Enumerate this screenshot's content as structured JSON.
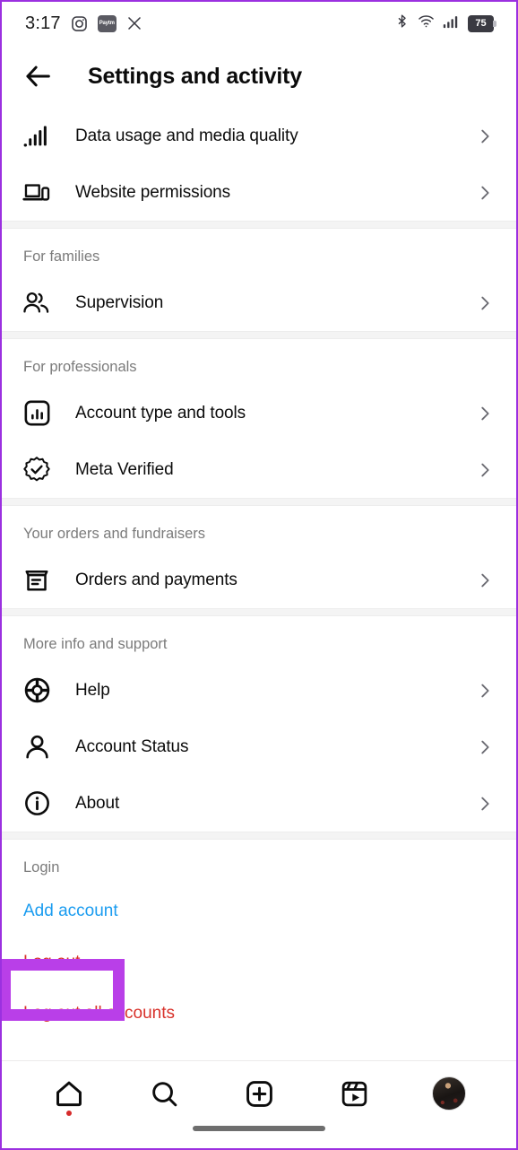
{
  "status_bar": {
    "time": "3:17",
    "left_icons": [
      "instagram-icon",
      "paytm-icon",
      "x-icon"
    ],
    "paytm_label": "Paytm",
    "right_icons": [
      "bluetooth-icon",
      "wifi-icon",
      "cellular-signal-icon"
    ],
    "battery_level": "75"
  },
  "header": {
    "back_label": "Back",
    "title": "Settings and activity"
  },
  "sections": [
    {
      "label": "",
      "rows": [
        {
          "icon": "signal-bars-icon",
          "label": "Data usage and media quality"
        },
        {
          "icon": "laptop-phone-icon",
          "label": "Website permissions"
        }
      ]
    },
    {
      "label": "For families",
      "rows": [
        {
          "icon": "people-icon",
          "label": "Supervision"
        }
      ]
    },
    {
      "label": "For professionals",
      "rows": [
        {
          "icon": "bar-chart-square-icon",
          "label": "Account type and tools"
        },
        {
          "icon": "verified-badge-icon",
          "label": "Meta Verified"
        }
      ]
    },
    {
      "label": "Your orders and fundraisers",
      "rows": [
        {
          "icon": "box-receipt-icon",
          "label": "Orders and payments"
        }
      ]
    },
    {
      "label": "More info and support",
      "rows": [
        {
          "icon": "lifebuoy-icon",
          "label": "Help"
        },
        {
          "icon": "person-icon",
          "label": "Account Status"
        },
        {
          "icon": "info-circle-icon",
          "label": "About"
        }
      ]
    }
  ],
  "login": {
    "label": "Login",
    "add_account": "Add account",
    "log_out": "Log out",
    "log_out_all": "Log out all accounts"
  },
  "bottom_nav": {
    "items": [
      {
        "icon": "home-icon",
        "label": "Home",
        "badge": true
      },
      {
        "icon": "search-icon",
        "label": "Search",
        "badge": false
      },
      {
        "icon": "create-plus-icon",
        "label": "Create",
        "badge": false
      },
      {
        "icon": "reels-icon",
        "label": "Reels",
        "badge": false
      },
      {
        "icon": "profile-avatar",
        "label": "Profile",
        "badge": false
      }
    ]
  },
  "annotation": {
    "highlight_target": "Log out",
    "highlight_color": "#b93fe8",
    "frame_color": "#9b30e0"
  },
  "colors": {
    "link_blue": "#1a9cf0",
    "danger_red": "#d8322b",
    "section_label_gray": "#7b7b7b",
    "divider_gray": "#f4f4f4"
  }
}
